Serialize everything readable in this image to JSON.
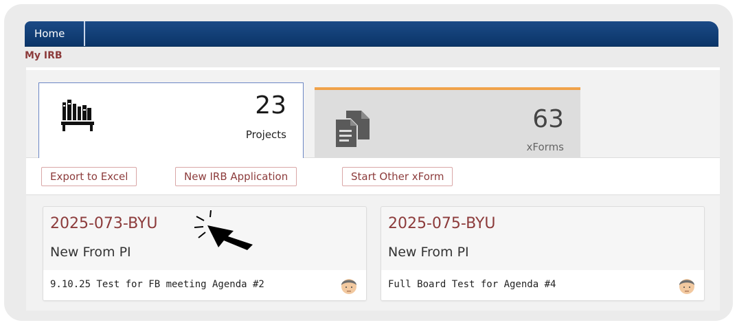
{
  "nav": {
    "home_tab": "Home"
  },
  "page": {
    "title": "My IRB"
  },
  "kpis": [
    {
      "value": "23",
      "label": "Projects",
      "icon": "bookshelf-icon"
    },
    {
      "value": "63",
      "label": "xForms",
      "icon": "documents-icon"
    }
  ],
  "toolbar": {
    "export_label": "Export to Excel",
    "new_app_label": "New IRB Application",
    "start_xform_label": "Start Other xForm"
  },
  "cards": [
    {
      "id": "2025-073-BYU",
      "status": "New From PI",
      "description": "9.10.25 Test for FB meeting Agenda #2",
      "avatar": "user-avatar-icon"
    },
    {
      "id": "2025-075-BYU",
      "status": "New From PI",
      "description": "Full Board Test for Agenda #4",
      "avatar": "user-avatar-icon"
    }
  ],
  "colors": {
    "nav_bg": "#0b3568",
    "accent": "#8c3b3b",
    "tab_active_border": "#6a86c4",
    "tab_highlight": "#f0a24a"
  },
  "cursor": "click-pointer-icon"
}
